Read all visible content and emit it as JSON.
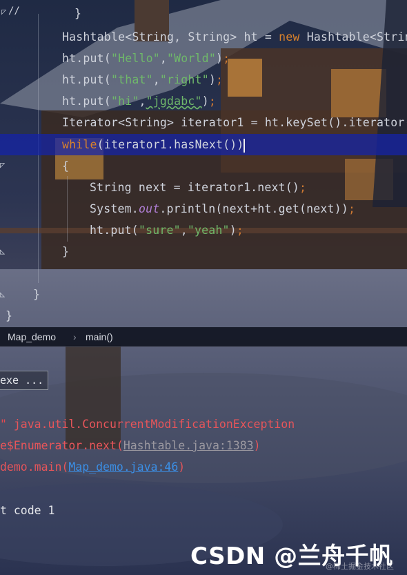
{
  "editor": {
    "gutter_top": "//",
    "lines": {
      "l0": "}",
      "l1a": "Hashtable<String, String> ht = ",
      "l1b": "new",
      "l1c": " Hashtable<Strin",
      "l2a": "ht.put(",
      "l2b": "\"Hello\"",
      "l2c": ",",
      "l2d": "\"World\"",
      "l2e": ")",
      "l2f": ";",
      "l3a": "ht.put(",
      "l3b": "\"that\"",
      "l3c": ",",
      "l3d": "\"right\"",
      "l3e": ")",
      "l3f": ";",
      "l4a": "ht.put(",
      "l4b": "\"hi\"",
      "l4c": ",",
      "l4d": "\"jgdabc\"",
      "l4e": ")",
      "l4f": ";",
      "l5": "Iterator<String> iterator1 = ht.keySet().iterator(",
      "l6a": "while",
      "l6b": "(iterator1.hasNext())",
      "l7": "{",
      "l8a": "String next = iterator1.next()",
      "l8b": ";",
      "l9a": "System.",
      "l9b": "out",
      "l9c": ".println(next+ht.get(next))",
      "l9d": ";",
      "l10a": "ht.put(",
      "l10b": "\"sure\"",
      "l10c": ",",
      "l10d": "\"yeah\"",
      "l10e": ")",
      "l10f": ";",
      "l11": "}",
      "l12": "}",
      "l13": "}"
    }
  },
  "breadcrumb": {
    "class_name": "Map_demo",
    "separator": "›",
    "method_name": "main()"
  },
  "console": {
    "run_label": "exe ...",
    "line1a": "\"",
    "line1b": " java.util.ConcurrentModificationException",
    "line2a": "e$Enumerator.next(",
    "line2b": "Hashtable.java:1383",
    "line2c": ")",
    "line3a": "demo.main(",
    "line3b": "Map_demo.java:46",
    "line3c": ")",
    "line4": "t code 1"
  },
  "watermark": {
    "text": "CSDN @兰舟千帆",
    "sub": "@稀土掘金技术社区"
  },
  "colors": {
    "keyword": "#d9822b",
    "string": "#6fb86a",
    "error": "#e8484e",
    "link": "#3b8fe6",
    "highlight": "#1423aa"
  }
}
